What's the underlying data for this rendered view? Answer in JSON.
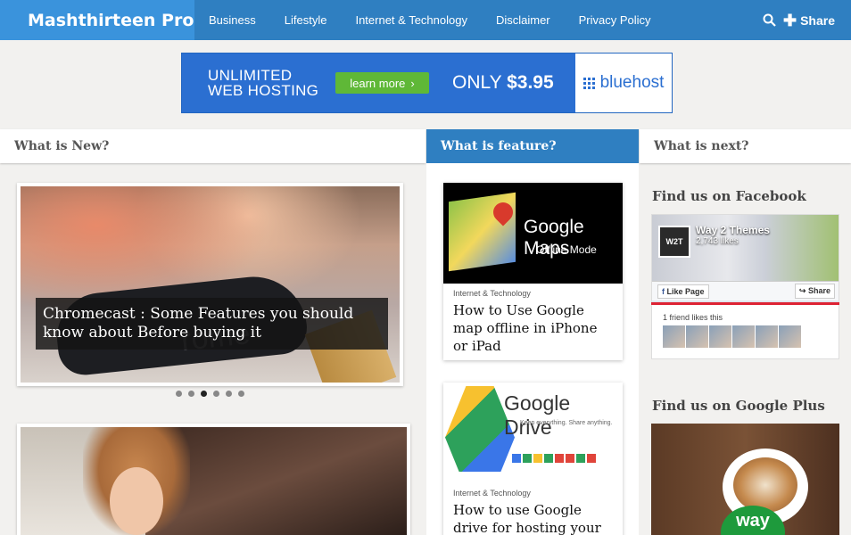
{
  "nav": {
    "brand": "Mashthirteen Pro",
    "items": [
      {
        "label": "Business"
      },
      {
        "label": "Lifestyle"
      },
      {
        "label": "Internet & Technology"
      },
      {
        "label": "Disclaimer"
      },
      {
        "label": "Privacy Policy"
      }
    ],
    "share_label": "Share",
    "search_icon": "search-icon",
    "share_icon": "plus-icon"
  },
  "banner": {
    "line1": "UNLIMITED",
    "line2": "WEB HOSTING",
    "cta": "learn more",
    "price_prefix": "ONLY",
    "price": "$3.95",
    "brand": "bluehost"
  },
  "columns": {
    "new_title": "What is New?",
    "feature_title": "What is feature?",
    "next_title": "What is next?"
  },
  "slider": {
    "caption": "Chromecast : Some Features you should know about Before buying it",
    "device_text": "rome",
    "dots_count": 6,
    "active_dot": 3
  },
  "feature_cards": [
    {
      "image_title": "Google Maps",
      "image_sub": "Offline Mode",
      "category": "Internet & Technology",
      "title": "How to Use Google map offline in iPhone or iPad"
    },
    {
      "image_title": "Google Drive",
      "image_sub": "Keep everything. Share anything.",
      "category": "Internet & Technology",
      "title": "How to use Google drive for hosting your website"
    }
  ],
  "sidebar": {
    "facebook_title": "Find us on Facebook",
    "fb_page_name": "Way 2 Themes",
    "fb_logo": "W2T",
    "fb_likes": "2,743 likes",
    "fb_like_button": "Like Page",
    "fb_share_button": "Share",
    "fb_friends": "1 friend likes this",
    "gplus_title": "Find us on Google Plus",
    "gplus_badge": "way"
  },
  "colors": {
    "nav_bg": "#2f7fc1",
    "brand_bg": "#3a93dc",
    "banner_bg": "#2b6fd1",
    "cta_bg": "#5fb837"
  }
}
